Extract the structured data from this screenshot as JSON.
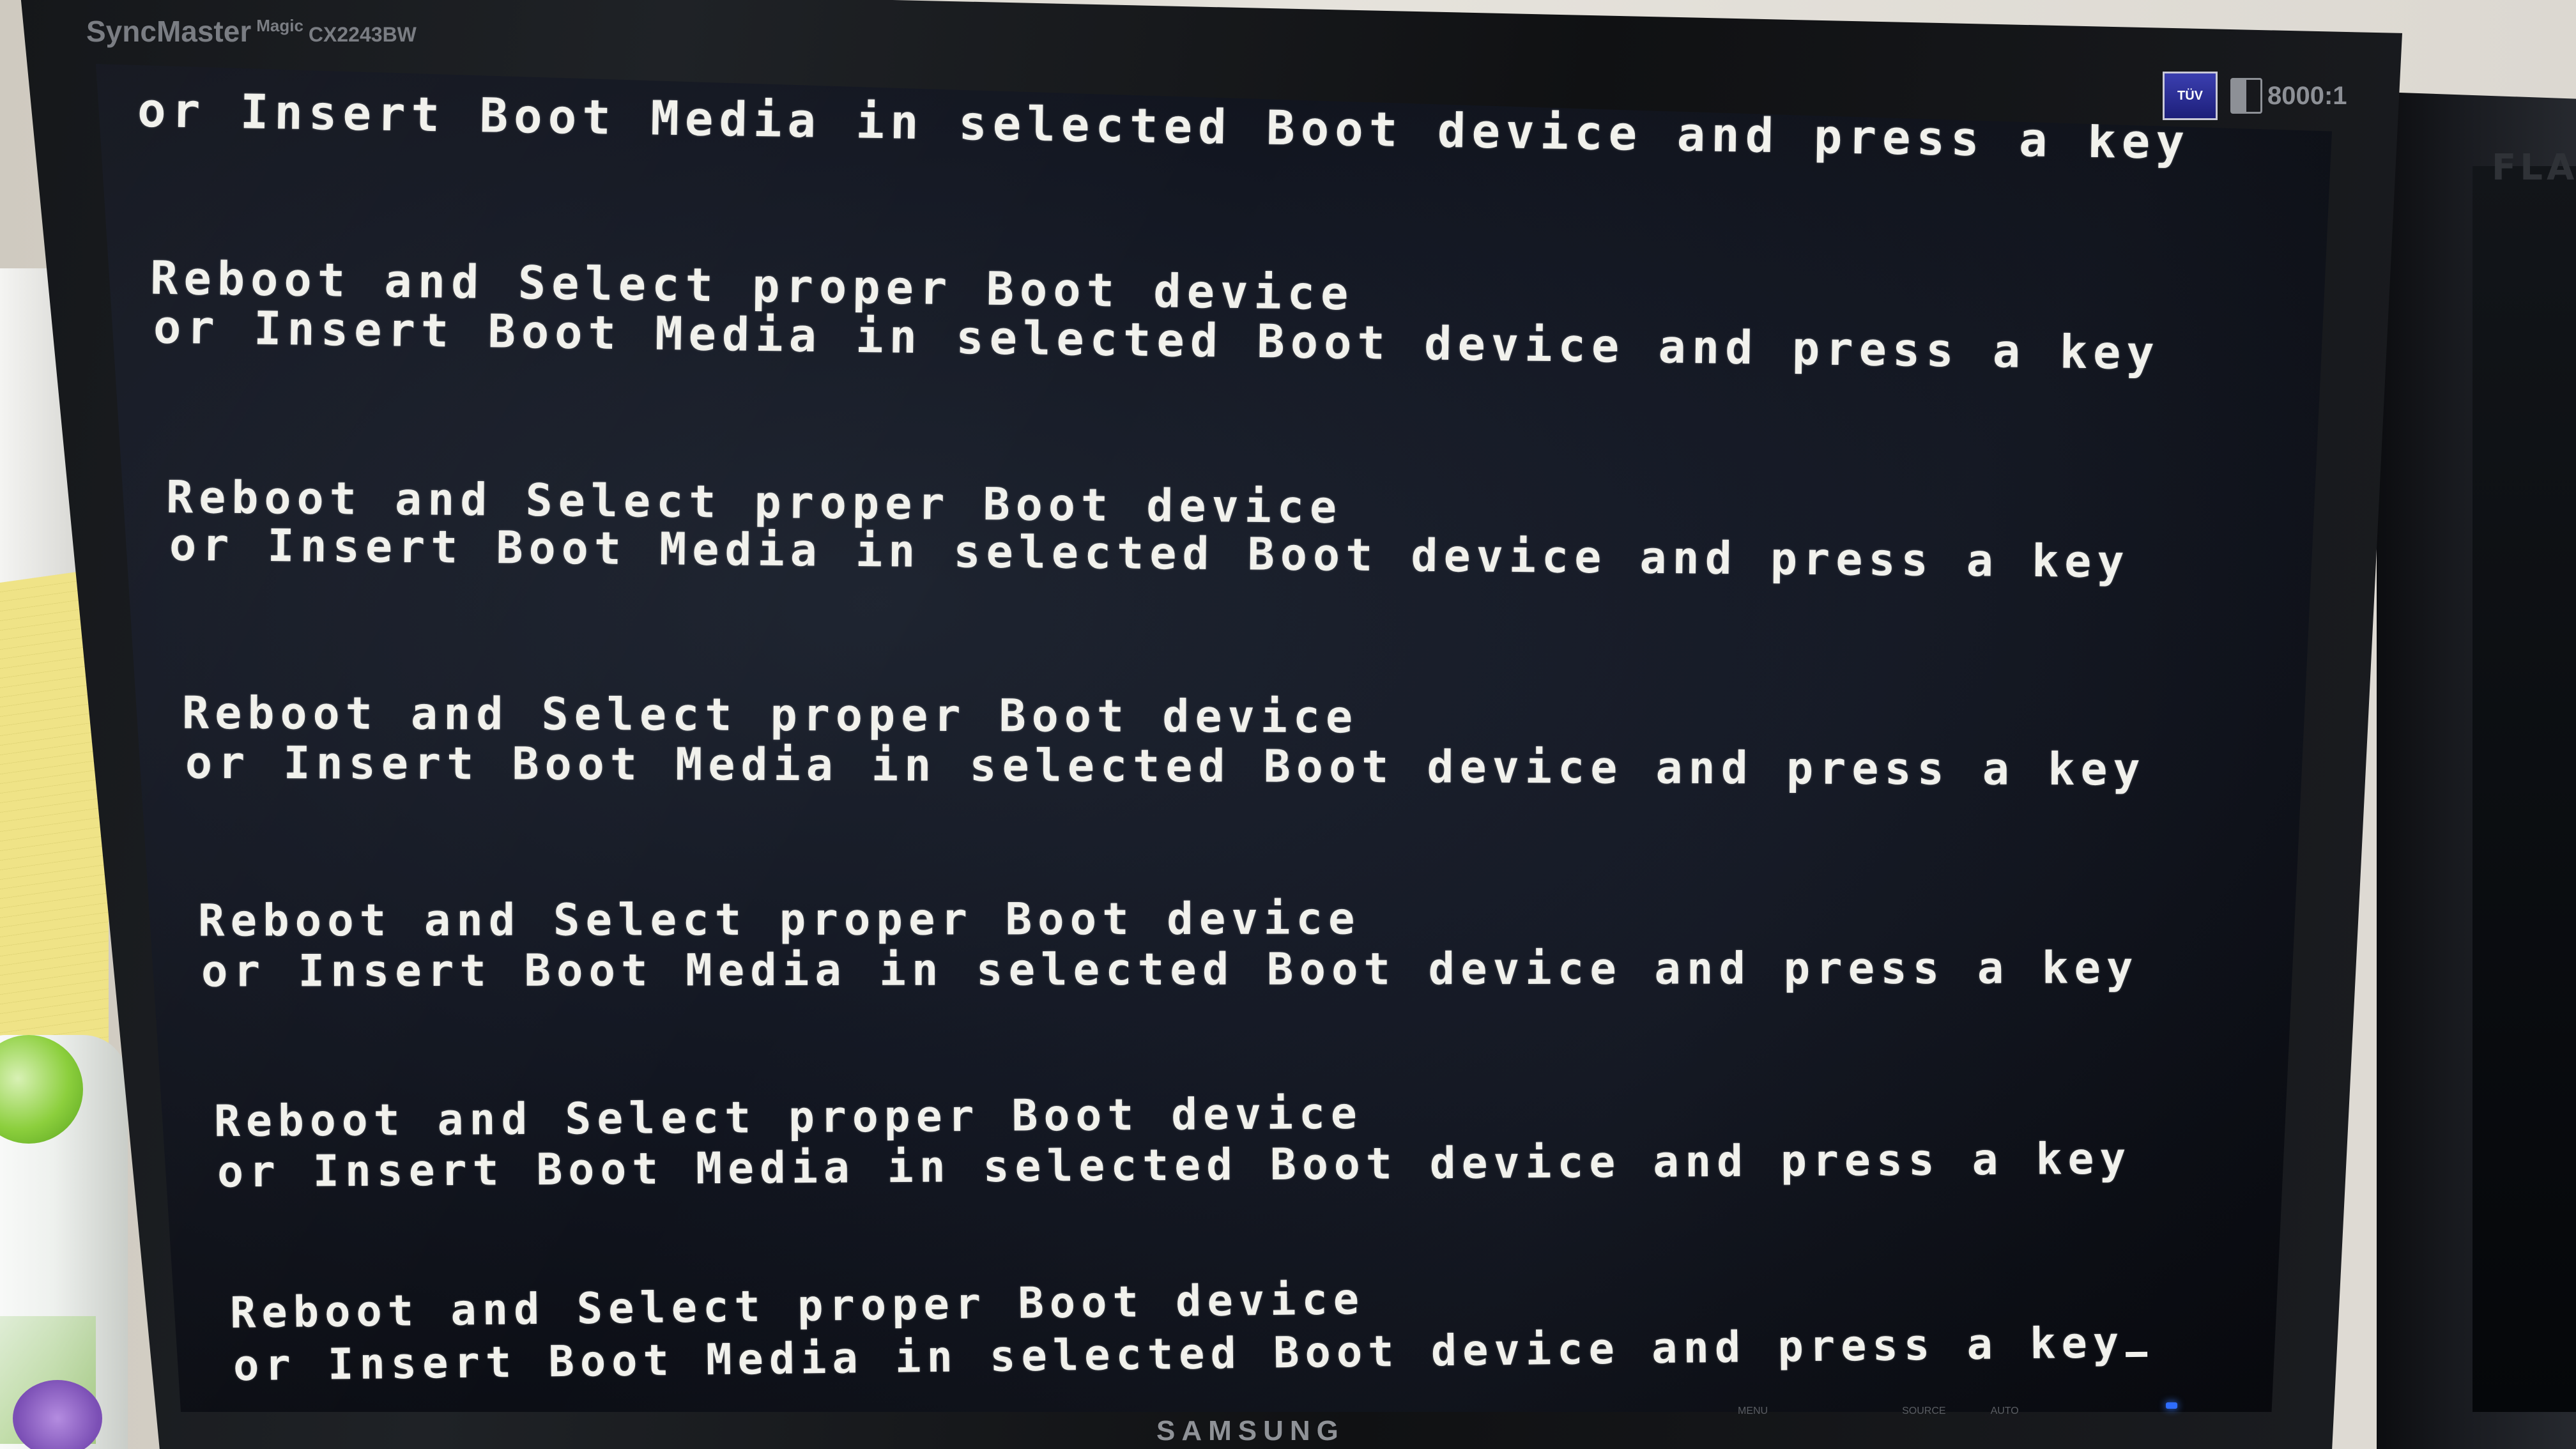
{
  "monitor": {
    "brand": "SyncMaster",
    "brand_suffix": "Magic",
    "model": "CX2243BW",
    "badge_text": "TÜV",
    "contrast_ratio": "8000:1",
    "bottom_brand": "SAMSUNG",
    "controls": [
      "MENU",
      "",
      "",
      "SOURCE",
      "AUTO",
      ""
    ]
  },
  "second_monitor": {
    "logo_partial": "FLA"
  },
  "boot_messages": {
    "line_a": "Reboot and Select proper Boot device",
    "line_b": "or Insert Boot Media in selected Boot device and press a key"
  },
  "colors": {
    "screen_text": "#f1f1ec",
    "screen_bg": "#0f131b",
    "power_led": "#2f6dff"
  }
}
